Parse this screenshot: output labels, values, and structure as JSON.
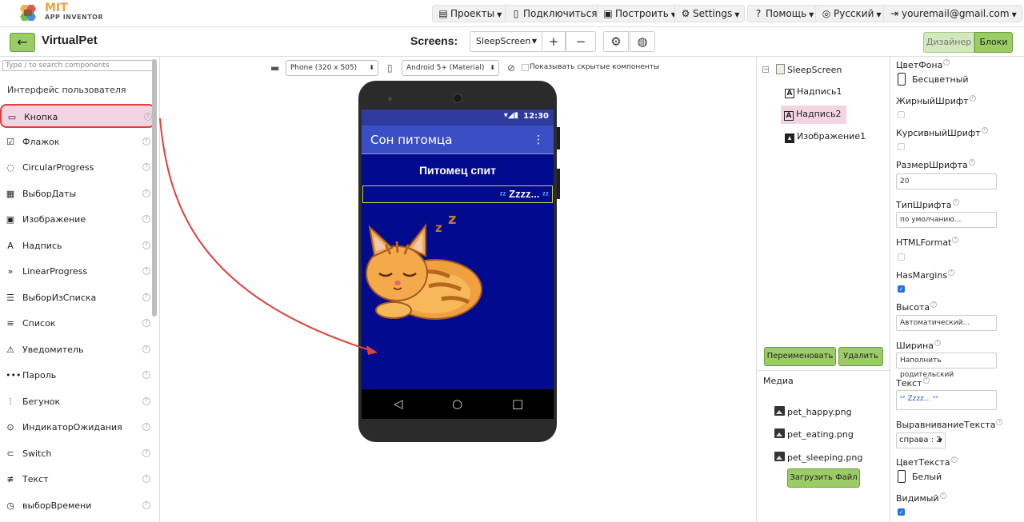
{
  "app": {
    "logo_main": "MIT",
    "logo_sub": "APP INVENTOR",
    "project_name": "VirtualPet"
  },
  "topmenu": {
    "projects": "Проекты",
    "connect": "Подключиться",
    "build": "Построить",
    "settings": "Settings",
    "help": "Помощь",
    "language": "Русский",
    "account": "youremail@gmail.com"
  },
  "toolbar": {
    "back_icon": "arrow-left-icon",
    "screens_label": "Screens:",
    "current_screen": "SleepScreen",
    "add_screen": "+",
    "remove_screen": "−",
    "designer": "Дизайнер",
    "blocks": "Блоки"
  },
  "palette": {
    "search_placeholder": "Type / to search components",
    "category": "Интерфейс пользователя",
    "items": [
      {
        "label": "Кнопка",
        "icon": "button-icon",
        "glyph": "▭"
      },
      {
        "label": "Флажок",
        "icon": "checkbox-icon",
        "glyph": "☑"
      },
      {
        "label": "CircularProgress",
        "icon": "circular-progress-icon",
        "glyph": "◌"
      },
      {
        "label": "ВыборДаты",
        "icon": "calendar-icon",
        "glyph": "▦"
      },
      {
        "label": "Изображение",
        "icon": "image-icon",
        "glyph": "▣"
      },
      {
        "label": "Надпись",
        "icon": "label-icon",
        "glyph": "A"
      },
      {
        "label": "LinearProgress",
        "icon": "linear-progress-icon",
        "glyph": "»"
      },
      {
        "label": "ВыборИзСписка",
        "icon": "listpicker-icon",
        "glyph": "☰"
      },
      {
        "label": "Список",
        "icon": "listview-icon",
        "glyph": "≡"
      },
      {
        "label": "Уведомитель",
        "icon": "notifier-icon",
        "glyph": "⚠"
      },
      {
        "label": "Пароль",
        "icon": "password-icon",
        "glyph": "•••"
      },
      {
        "label": "Бегунок",
        "icon": "slider-icon",
        "glyph": "⫶"
      },
      {
        "label": "ИндикаторОжидания",
        "icon": "spinner-icon",
        "glyph": "⊙"
      },
      {
        "label": "Switch",
        "icon": "switch-icon",
        "glyph": "⊂"
      },
      {
        "label": "Текст",
        "icon": "textbox-icon",
        "glyph": "≢"
      },
      {
        "label": "выборВремени",
        "icon": "timepicker-icon",
        "glyph": "◷"
      }
    ],
    "help_glyph": "?"
  },
  "viewer": {
    "device": "Phone (320 x 505)",
    "theme": "Android 5+ (Material)",
    "show_hidden": "Показывать скрытые компоненты",
    "status_time": "12:30",
    "status_icons": "▾◢▮",
    "app_title": "Сон питомца",
    "label1": "Питомец спит",
    "label2_text": "Zzzz...",
    "label2_zz": "ᶻᶻ",
    "nav_back": "◁",
    "nav_home": "○",
    "nav_recent": "□",
    "more_glyph": "⋮"
  },
  "tree": {
    "root": "SleepScreen",
    "items": [
      "Надпись1",
      "Надпись2",
      "Изображение1"
    ],
    "rename": "Переименовать",
    "delete": "Удалить"
  },
  "media": {
    "title": "Медиа",
    "files": [
      "pet_happy.png",
      "pet_eating.png",
      "pet_sleeping.png"
    ],
    "upload": "Загрузить Файл"
  },
  "properties": {
    "bgcolor_label": "ЦветФона",
    "bgcolor_value": "Бесцветный",
    "bold_label": "ЖирныйШрифт",
    "italic_label": "КурсивныйШрифт",
    "fontsize_label": "РазмерШрифта",
    "fontsize_value": "20",
    "typeface_label": "ТипШрифта",
    "typeface_value": "по умолчанию...",
    "html_label": "HTMLFormat",
    "margins_label": "HasMargins",
    "height_label": "Высота",
    "height_value": "Автоматический...",
    "width_label": "Ширина",
    "width_value": "Наполнить родительский",
    "text_label": "Текст",
    "text_value": "ᶻᶻ Zzzz... ᶻᶻ",
    "align_label": "ВыравниваниеТекста",
    "align_value": "справа : 2",
    "textcolor_label": "ЦветТекста",
    "textcolor_value": "Белый",
    "visible_label": "Видимый"
  },
  "colors": {
    "accent_green": "#9ccc65",
    "screen_bg": "#020a8e",
    "appbar": "#3b4fc4",
    "selection": "#f4d3e3",
    "highlight_border": "#e0403a"
  }
}
